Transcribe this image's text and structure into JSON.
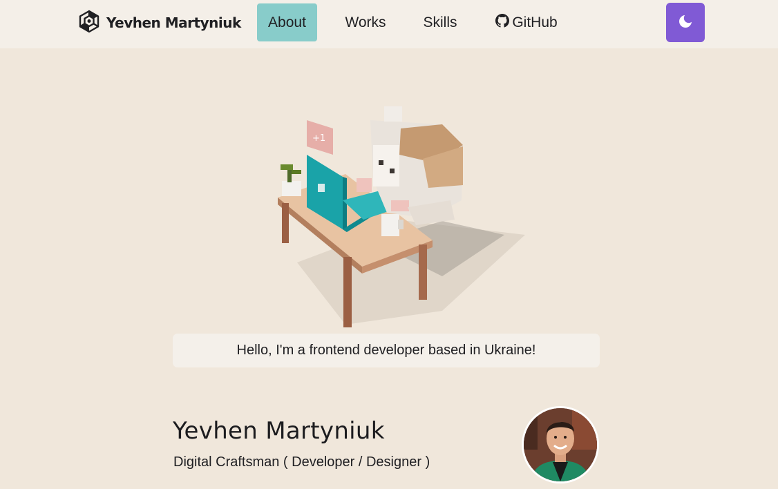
{
  "header": {
    "logo_text": "Yevhen Martyniuk",
    "nav": {
      "about": "About",
      "works": "Works",
      "skills": "Skills",
      "github": "GitHub"
    }
  },
  "hero": {
    "greeting": "Hello, I'm a frontend developer based in Ukraine!",
    "laptop_sticker": "+1"
  },
  "profile": {
    "name": "Yevhen Martyniuk",
    "role": "Digital Craftsman ( Developer / Designer )"
  },
  "colors": {
    "background": "#f0e7db",
    "active_nav": "#88ccca",
    "theme_toggle": "#805ad5"
  }
}
